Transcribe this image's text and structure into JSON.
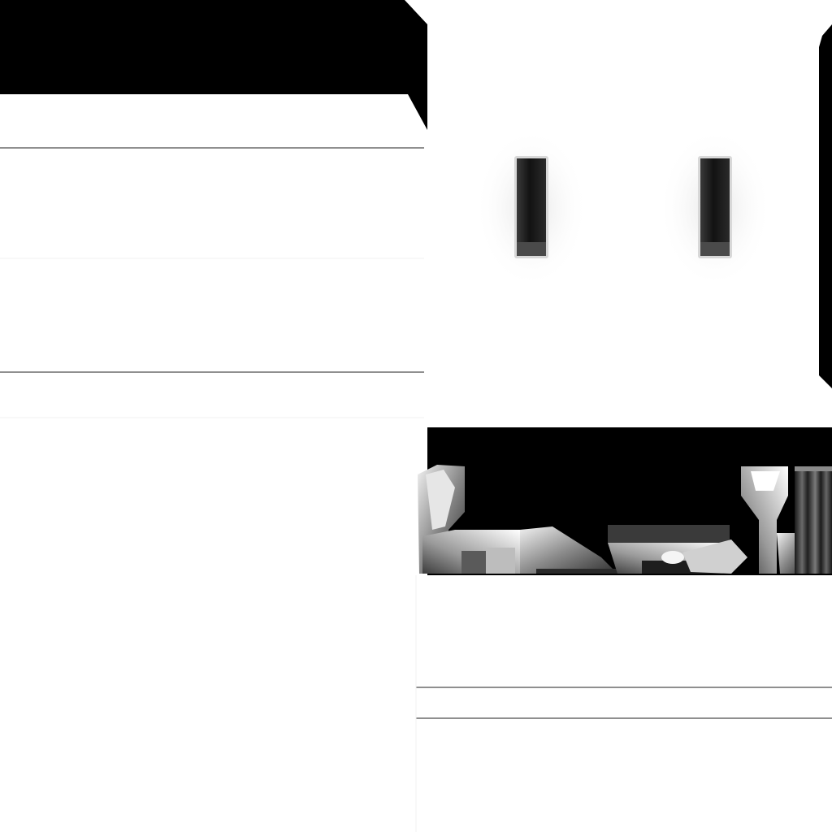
{
  "texture": {
    "base_color": "#ffffff",
    "void_color": "#000000",
    "seam_color": "#6a6a6a",
    "slot_color": "#1a1a1a"
  }
}
